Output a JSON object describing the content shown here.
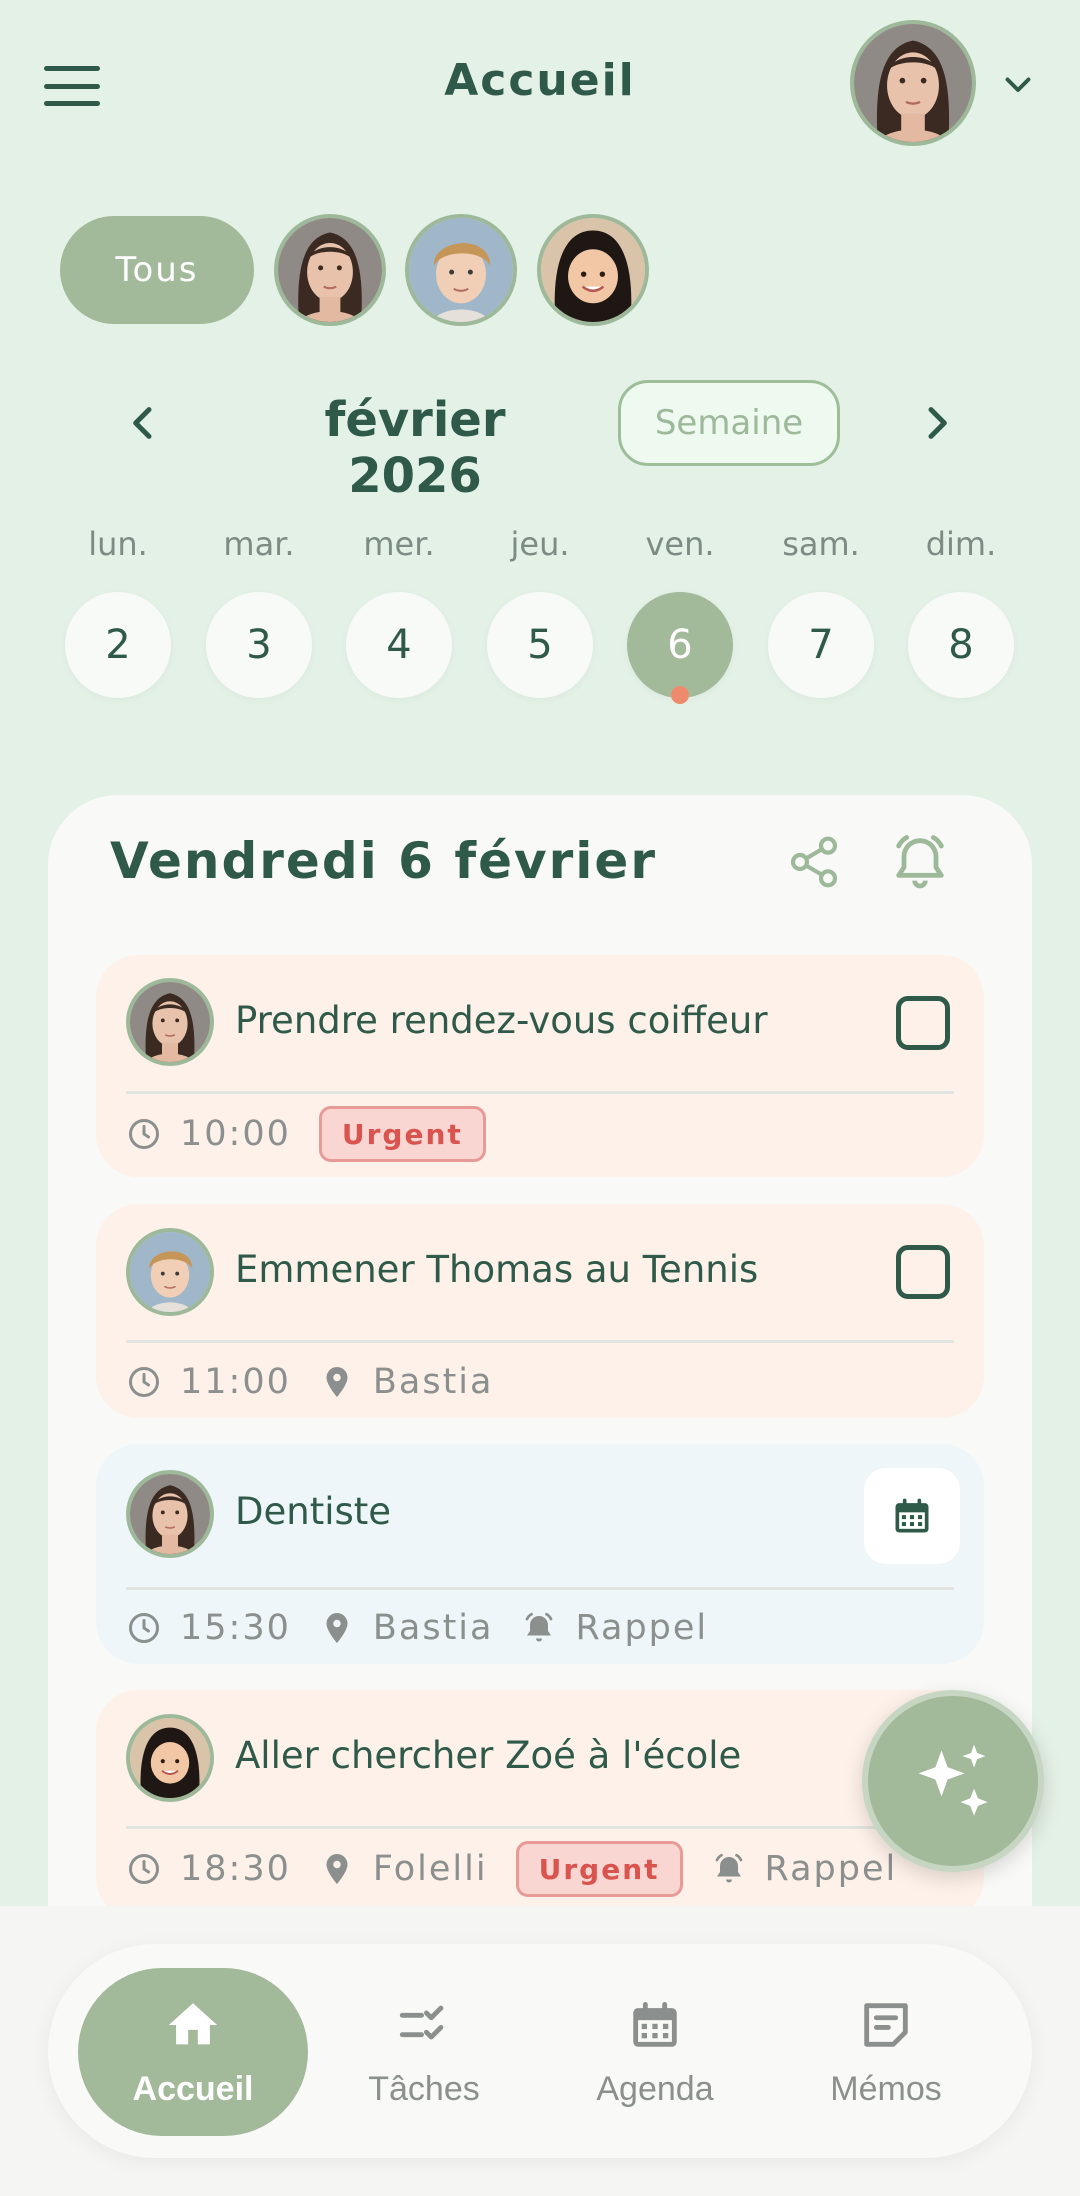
{
  "header": {
    "title": "Accueil",
    "menu_icon": "menu-icon",
    "profile_icon": "chevron-down-icon"
  },
  "filters": {
    "all_label": "Tous"
  },
  "calendar": {
    "month": "février 2026",
    "view_label": "Semaine",
    "days_of_week": [
      "lun.",
      "mar.",
      "mer.",
      "jeu.",
      "ven.",
      "sam.",
      "dim."
    ],
    "dates": [
      "2",
      "3",
      "4",
      "5",
      "6",
      "7",
      "8"
    ],
    "selected_index": 4
  },
  "day_card": {
    "title": "Vendredi 6 février",
    "tasks": [
      {
        "title": "Prendre rendez-vous coiffeur",
        "time": "10:00",
        "badge": "Urgent"
      },
      {
        "title": "Emmener Thomas au Tennis",
        "time": "11:00",
        "location": "Bastia"
      },
      {
        "title": "Dentiste",
        "time": "15:30",
        "location": "Bastia",
        "reminder": "Rappel"
      },
      {
        "title": "Aller chercher Zoé à l'école",
        "time": "18:30",
        "location": "Folelli",
        "badge": "Urgent",
        "reminder": "Rappel"
      }
    ]
  },
  "bottom_nav": {
    "items": [
      {
        "label": "Accueil"
      },
      {
        "label": "Tâches"
      },
      {
        "label": "Agenda"
      },
      {
        "label": "Mémos"
      }
    ]
  },
  "colors": {
    "background": "#e4f1e6",
    "accent": "#a2b99a",
    "primary_text": "#2f5a49",
    "urgent": "#d9534f",
    "peach_card": "#fdf1e9",
    "blue_card": "#eef6f9"
  }
}
